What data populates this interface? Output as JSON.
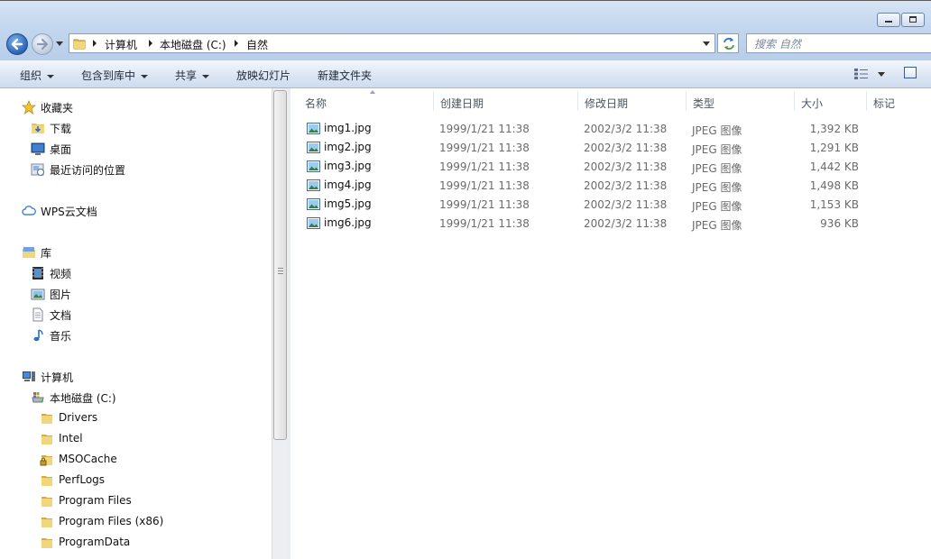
{
  "window": {
    "minimize_label": "",
    "maximize_label": ""
  },
  "address": {
    "crumbs": [
      "计算机",
      "本地磁盘 (C:)",
      "自然"
    ]
  },
  "search": {
    "placeholder": "搜索 自然"
  },
  "toolbar": {
    "organize": "组织",
    "include_library": "包含到库中",
    "share": "共享",
    "slideshow": "放映幻灯片",
    "new_folder": "新建文件夹"
  },
  "nav": {
    "favorites": {
      "label": "收藏夹",
      "items": [
        "下载",
        "桌面",
        "最近访问的位置"
      ]
    },
    "wps": "WPS云文档",
    "libraries": {
      "label": "库",
      "items": [
        "视频",
        "图片",
        "文档",
        "音乐"
      ]
    },
    "computer": {
      "label": "计算机",
      "drive": "本地磁盘 (C:)",
      "folders": [
        "Drivers",
        "Intel",
        "MSOCache",
        "PerfLogs",
        "Program Files",
        "Program Files (x86)",
        "ProgramData"
      ]
    }
  },
  "columns": {
    "name": "名称",
    "created": "创建日期",
    "modified": "修改日期",
    "type": "类型",
    "size": "大小",
    "tags": "标记"
  },
  "files": [
    {
      "name": "img1.jpg",
      "created": "1999/1/21 11:38",
      "modified": "2002/3/2 11:38",
      "type": "JPEG 图像",
      "size": "1,392 KB"
    },
    {
      "name": "img2.jpg",
      "created": "1999/1/21 11:38",
      "modified": "2002/3/2 11:38",
      "type": "JPEG 图像",
      "size": "1,291 KB"
    },
    {
      "name": "img3.jpg",
      "created": "1999/1/21 11:38",
      "modified": "2002/3/2 11:38",
      "type": "JPEG 图像",
      "size": "1,442 KB"
    },
    {
      "name": "img4.jpg",
      "created": "1999/1/21 11:38",
      "modified": "2002/3/2 11:38",
      "type": "JPEG 图像",
      "size": "1,498 KB"
    },
    {
      "name": "img5.jpg",
      "created": "1999/1/21 11:38",
      "modified": "2002/3/2 11:38",
      "type": "JPEG 图像",
      "size": "1,153 KB"
    },
    {
      "name": "img6.jpg",
      "created": "1999/1/21 11:38",
      "modified": "2002/3/2 11:38",
      "type": "JPEG 图像",
      "size": "936 KB"
    }
  ],
  "colors": {
    "accent": "#2b64b8",
    "folder": "#e8c25a",
    "selection": "#cce8ff"
  }
}
